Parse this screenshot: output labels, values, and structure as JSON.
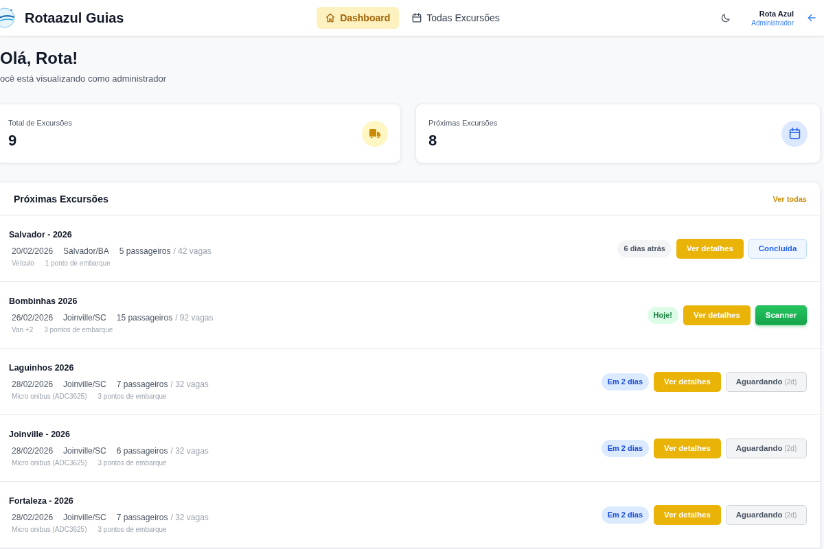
{
  "header": {
    "brand": "Rotaazul Guias",
    "nav": [
      {
        "label": "Dashboard",
        "selected": true
      },
      {
        "label": "Todas Excursões",
        "selected": false
      }
    ],
    "user": {
      "name": "Rota Azul",
      "role": "Administrador"
    }
  },
  "greeting": {
    "title": "Olá, Rota!",
    "subtitle": "ocê está visualizando como administrador"
  },
  "stats": [
    {
      "label": "Total de Excursões",
      "value": "9"
    },
    {
      "label": "Próximas Excursões",
      "value": "8"
    }
  ],
  "excursions": {
    "title": "Próximas Excursões",
    "link": "Ver todas",
    "items": [
      {
        "name": "Salvador - 2026",
        "date": "20/02/2026",
        "city": "Salvador/BA",
        "passengers": "5 passageiros",
        "seats": "/ 42 vagas",
        "vehicle": "Veículo",
        "boarding": "1 ponto de embarque",
        "badge": {
          "kind": "past",
          "text": "6 dias atrás"
        },
        "details": "Ver detalhes",
        "action": {
          "kind": "done",
          "label": "Concluída"
        }
      },
      {
        "name": "Bombinhas 2026",
        "date": "26/02/2026",
        "city": "Joinville/SC",
        "passengers": "15 passageiros",
        "seats": "/ 92 vagas",
        "vehicle": "Van +2",
        "boarding": "3 pontos de embarque",
        "badge": {
          "kind": "today",
          "text": "Hoje!"
        },
        "details": "Ver detalhes",
        "action": {
          "kind": "scanner",
          "label": "Scanner"
        }
      },
      {
        "name": "Laguinhos 2026",
        "date": "28/02/2026",
        "city": "Joinville/SC",
        "passengers": "7 passageiros",
        "seats": "/ 32 vagas",
        "vehicle": "Micro onibus (ADC3625)",
        "boarding": "3 pontos de embarque",
        "badge": {
          "kind": "soon",
          "text": "Em 2 dias"
        },
        "details": "Ver detalhes",
        "action": {
          "kind": "waiting",
          "label": "Aguardando",
          "note": "(2d)"
        }
      },
      {
        "name": "Joinville - 2026",
        "date": "28/02/2026",
        "city": "Joinville/SC",
        "passengers": "6 passageiros",
        "seats": "/ 32 vagas",
        "vehicle": "Micro onibus (ADC3625)",
        "boarding": "3 pontos de embarque",
        "badge": {
          "kind": "soon",
          "text": "Em 2 dias"
        },
        "details": "Ver detalhes",
        "action": {
          "kind": "waiting",
          "label": "Aguardando",
          "note": "(2d)"
        }
      },
      {
        "name": "Fortaleza - 2026",
        "date": "28/02/2026",
        "city": "Joinville/SC",
        "passengers": "7 passageiros",
        "seats": "/ 32 vagas",
        "vehicle": "Micro onibus (ADC3625)",
        "boarding": "3 pontos de embarque",
        "badge": {
          "kind": "soon",
          "text": "Em 2 dias"
        },
        "details": "Ver detalhes",
        "action": {
          "kind": "waiting",
          "label": "Aguardando",
          "note": "(2d)"
        }
      }
    ]
  }
}
